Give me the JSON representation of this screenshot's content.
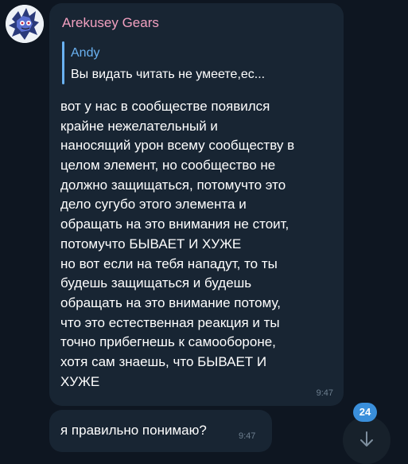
{
  "sender": {
    "name": "Arekusey Gears",
    "name_color": "#f2a0c0"
  },
  "reply": {
    "author": "Andy",
    "text": "Вы видать читать не умеете,ес..."
  },
  "messages": [
    {
      "lines": [
        "вот у нас в сообществе появился",
        "крайне нежелательный и",
        "наносящий урон всему сообществу в",
        "целом элемент, но сообщество не",
        "должно защищаться, потомучто это",
        "дело сугубо этого элемента и",
        "обращать на это внимания не стоит,",
        "потомучто БЫВАЕТ И ХУЖЕ",
        "но вот если на тебя нападут, то ты",
        "будешь защищаться и будешь",
        "обращать на это внимание потому,",
        "что это естественная реакция и ты",
        "точно прибегнешь к самообороне,",
        "хотя сам знаешь, что БЫВАЕТ И",
        "ХУЖЕ"
      ],
      "time": "9:47"
    },
    {
      "text": "я правильно понимаю?",
      "time": "9:47"
    }
  ],
  "scroll_button": {
    "unread_count": "24",
    "icon": "arrow-down-icon"
  },
  "colors": {
    "background": "#0e1621",
    "bubble": "#182533",
    "accent": "#6ab2f2",
    "badge": "#3a8fdb",
    "time": "#6d7f8f"
  }
}
